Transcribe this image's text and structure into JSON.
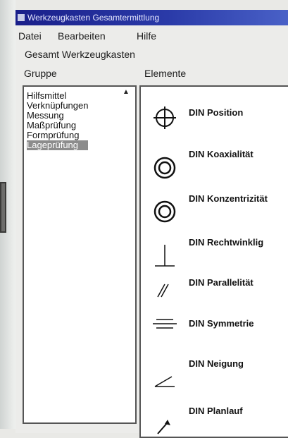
{
  "window": {
    "title": "Werkzeugkasten Gesamtermittlung"
  },
  "menu": {
    "datei": "Datei",
    "bearbeiten": "Bearbeiten",
    "hilfe": "Hilfe"
  },
  "section_title": "Gesamt Werkzeugkasten",
  "group": {
    "label": "Gruppe",
    "items": [
      "Hilfsmittel",
      "Verknüpfungen",
      "Messung",
      "Maßprüfung",
      "Formprüfung",
      "Lageprüfung"
    ],
    "selected_index": 5
  },
  "elements": {
    "label": "Elemente",
    "items": [
      {
        "label": "DIN Position",
        "icon": "position-icon"
      },
      {
        "label": "DIN Koaxialität",
        "icon": "coaxiality-icon"
      },
      {
        "label": "DIN Konzentrizität",
        "icon": "concentricity-icon"
      },
      {
        "label": "DIN Rechtwinklig",
        "icon": "perpendicularity-icon"
      },
      {
        "label": "DIN Parallelität",
        "icon": "parallelism-icon"
      },
      {
        "label": "DIN Symmetrie",
        "icon": "symmetry-icon"
      },
      {
        "label": "DIN Neigung",
        "icon": "angularity-icon"
      },
      {
        "label": "DIN Planlauf",
        "icon": "runout-icon"
      }
    ]
  }
}
